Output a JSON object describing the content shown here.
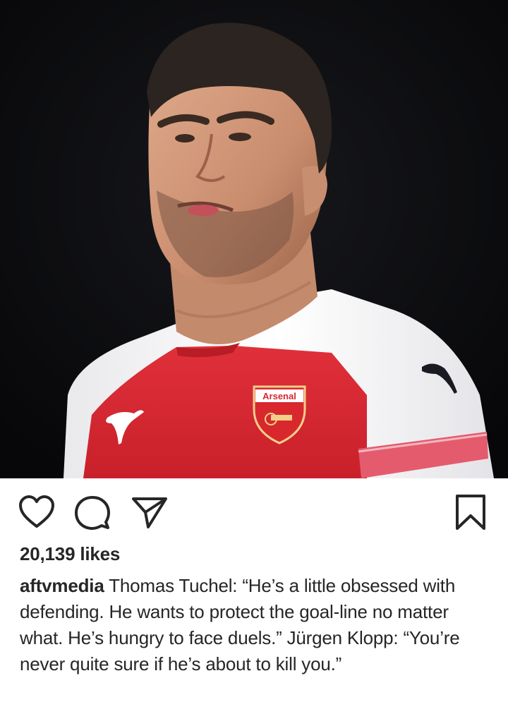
{
  "post": {
    "image_alt": "Footballer in a red and white kit",
    "crest_text": "Arsenal",
    "likes_text": "20,139 likes",
    "username": "aftvmedia",
    "caption_text": "Thomas Tuchel: “He’s a little obsessed with defending. He wants to protect the goal-line no matter what. He’s hungry to face duels.” Jürgen Klopp: “You’re never quite sure if he’s about to kill you.”"
  },
  "actions": {
    "like": "heart-icon",
    "comment": "comment-bubble-icon",
    "share": "paper-plane-icon",
    "save": "bookmark-icon"
  },
  "colors": {
    "text": "#262626",
    "background": "#ffffff",
    "kit_red": "#d9272e"
  }
}
